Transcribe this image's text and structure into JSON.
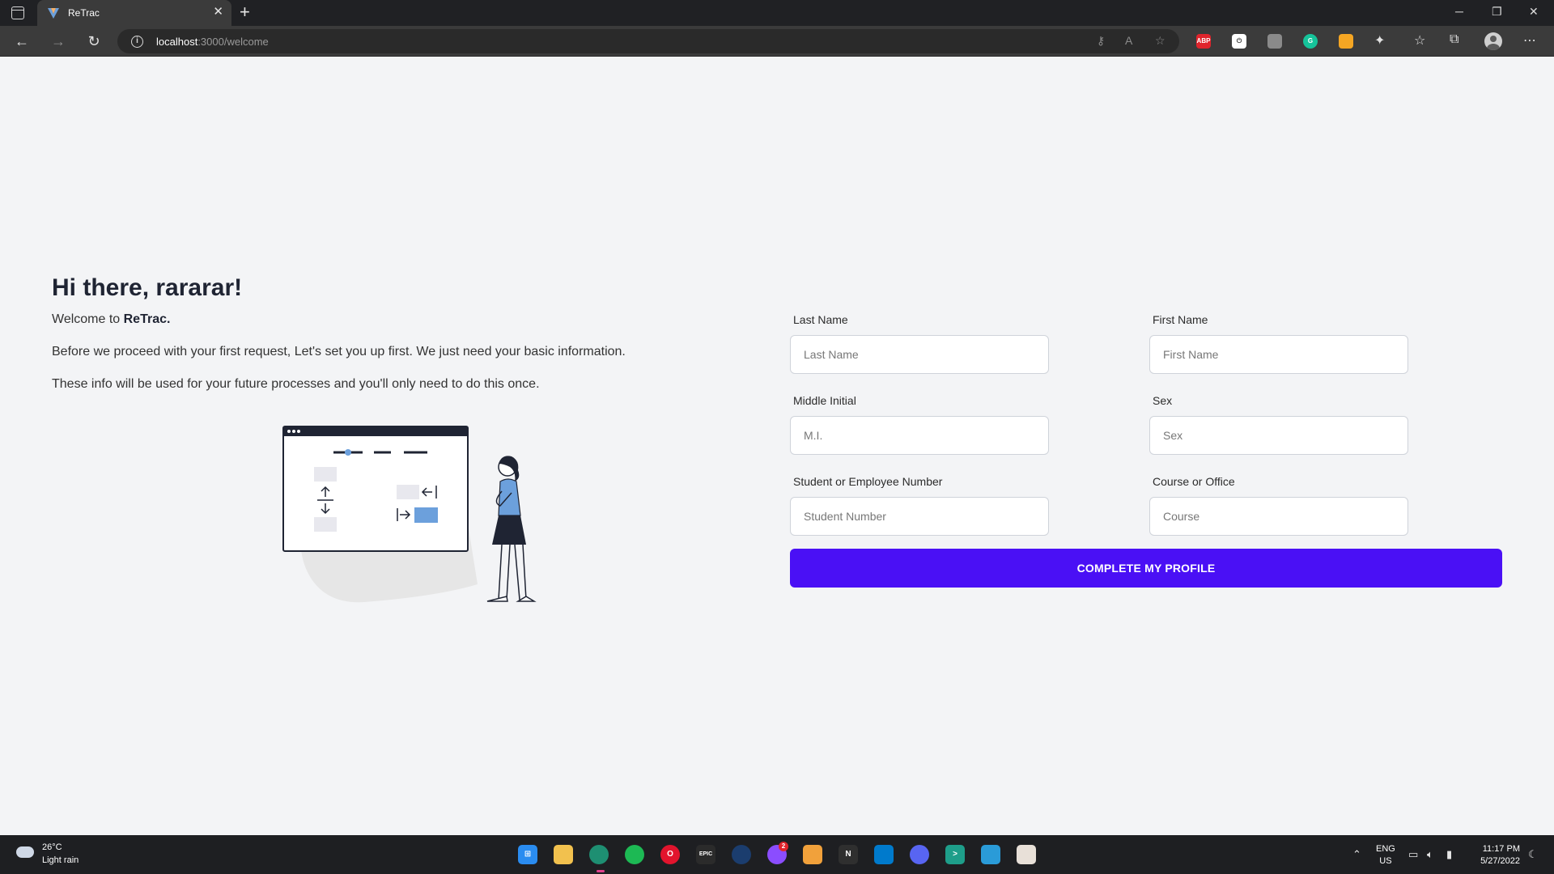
{
  "browser": {
    "tab_title": "ReTrac",
    "tab_close": "✕",
    "new_tab": "+",
    "url_host": "localhost",
    "url_path": ":3000/welcome",
    "extensions": [
      "ABP"
    ]
  },
  "page": {
    "greeting": "Hi there, rararar!",
    "welcome_prefix": "Welcome to ",
    "brand": "ReTrac.",
    "paragraph1": "Before we proceed with your first request, Let's set you up first. We just need your basic information.",
    "paragraph2": "These info will be used for your future processes and you'll only need to do this once."
  },
  "form": {
    "fields": [
      {
        "label": "Last Name",
        "placeholder": "Last Name",
        "value": ""
      },
      {
        "label": "First Name",
        "placeholder": "First Name",
        "value": ""
      },
      {
        "label": "Middle Initial",
        "placeholder": "M.I.",
        "value": ""
      },
      {
        "label": "Sex",
        "placeholder": "Sex",
        "value": ""
      },
      {
        "label": "Student or Employee Number",
        "placeholder": "Student Number",
        "value": ""
      },
      {
        "label": "Course or Office",
        "placeholder": "Course",
        "value": ""
      }
    ],
    "submit_label": "COMPLETE MY PROFILE"
  },
  "colors": {
    "accent": "#4a10f5",
    "background": "#f3f4f6",
    "illustration_blue": "#6ca0dc"
  },
  "taskbar": {
    "temperature": "26°C",
    "weather": "Light rain",
    "lang_top": "ENG",
    "lang_bottom": "US",
    "time": "11:17 PM",
    "date": "5/27/2022",
    "messenger_badge": "2"
  }
}
